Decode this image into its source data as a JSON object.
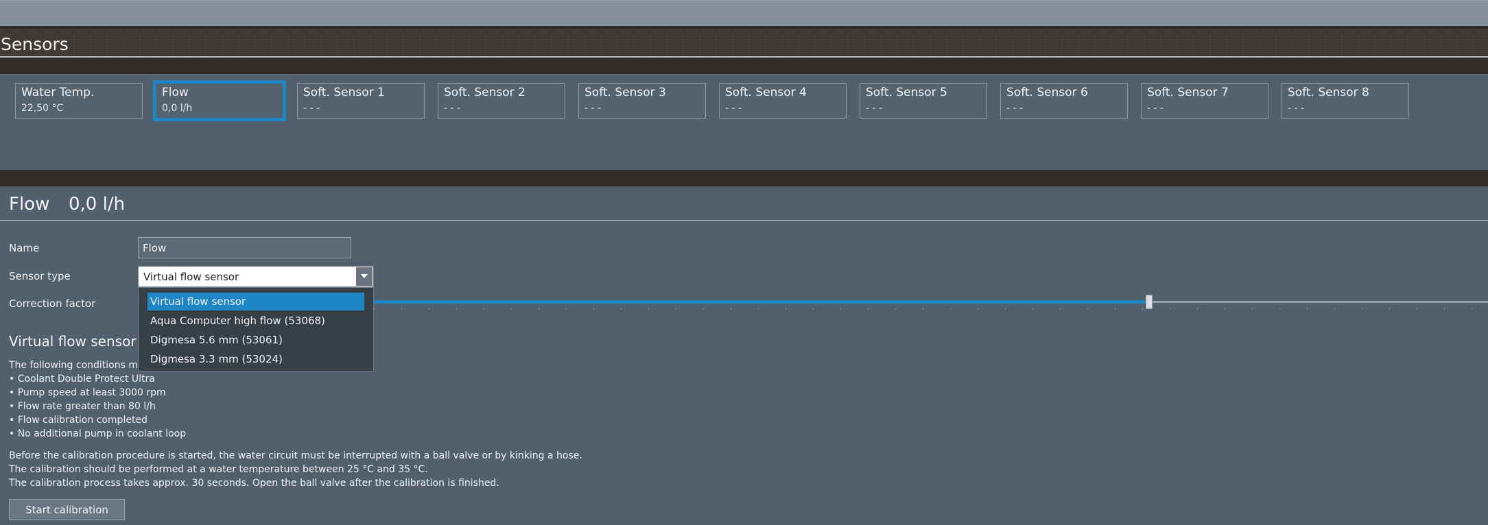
{
  "header": {
    "title": "Sensors"
  },
  "tiles": [
    {
      "name": "Water Temp.",
      "value": "22,50 °C"
    },
    {
      "name": "Flow",
      "value": "0,0 l/h"
    },
    {
      "name": "Soft. Sensor 1",
      "value": "- - -"
    },
    {
      "name": "Soft. Sensor 2",
      "value": "- - -"
    },
    {
      "name": "Soft. Sensor 3",
      "value": "- - -"
    },
    {
      "name": "Soft. Sensor 4",
      "value": "- - -"
    },
    {
      "name": "Soft. Sensor 5",
      "value": "- - -"
    },
    {
      "name": "Soft. Sensor 6",
      "value": "- - -"
    },
    {
      "name": "Soft. Sensor 7",
      "value": "- - -"
    },
    {
      "name": "Soft. Sensor 8",
      "value": "- - -"
    }
  ],
  "detail": {
    "title": "Flow",
    "value": "0,0 l/h",
    "name_label": "Name",
    "name_value": "Flow",
    "sensor_type_label": "Sensor type",
    "sensor_type_value": "Virtual flow sensor",
    "correction_label": "Correction factor",
    "correction_fraction": 0.7
  },
  "dropdown": {
    "options": [
      "Virtual flow sensor",
      "Aqua Computer high flow (53068)",
      "Digmesa 5.6 mm (53061)",
      "Digmesa 3.3 mm (53024)"
    ]
  },
  "info": {
    "title": "Virtual flow sensor",
    "intro": "The following conditions mu",
    "conditions": [
      "• Coolant Double Protect Ultra",
      "• Pump speed at least 3000 rpm",
      "• Flow rate greater than 80 l/h",
      "• Flow calibration completed",
      "• No additional pump in coolant loop"
    ],
    "notes": [
      "Before the calibration procedure is started, the water circuit must be interrupted with a ball valve or by kinking a hose.",
      "The calibration should be performed at a water temperature between 25 °C and 35 °C.",
      "The calibration process takes approx. 30 seconds. Open the ball valve after the calibration is finished."
    ],
    "button": "Start calibration"
  },
  "colors": {
    "accent": "#1f86c5",
    "panel": "#52606d",
    "separator": "#2f2c2a"
  }
}
